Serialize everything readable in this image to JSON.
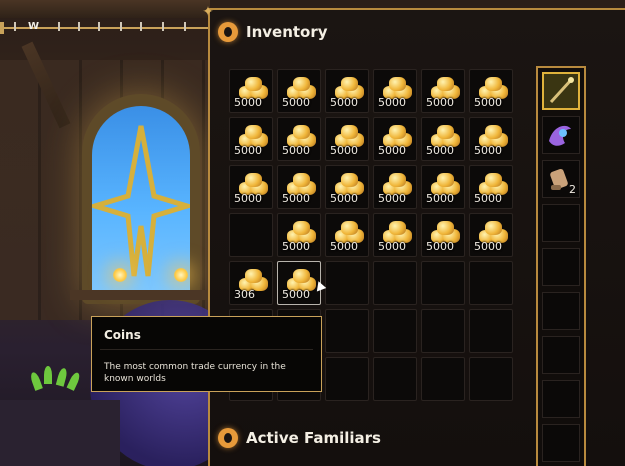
{
  "compass": {
    "heading_letter": "W"
  },
  "inventory": {
    "title": "Inventory",
    "slots": [
      {
        "item": "coins",
        "qty": "5000"
      },
      {
        "item": "coins",
        "qty": "5000"
      },
      {
        "item": "coins",
        "qty": "5000"
      },
      {
        "item": "coins",
        "qty": "5000"
      },
      {
        "item": "coins",
        "qty": "5000"
      },
      {
        "item": "coins",
        "qty": "5000"
      },
      {
        "item": "coins",
        "qty": "5000"
      },
      {
        "item": "coins",
        "qty": "5000"
      },
      {
        "item": "coins",
        "qty": "5000"
      },
      {
        "item": "coins",
        "qty": "5000"
      },
      {
        "item": "coins",
        "qty": "5000"
      },
      {
        "item": "coins",
        "qty": "5000"
      },
      {
        "item": "coins",
        "qty": "5000"
      },
      {
        "item": "coins",
        "qty": "5000"
      },
      {
        "item": "coins",
        "qty": "5000"
      },
      {
        "item": "coins",
        "qty": "5000"
      },
      {
        "item": "coins",
        "qty": "5000"
      },
      {
        "item": "coins",
        "qty": "5000"
      },
      {
        "item": "",
        "qty": ""
      },
      {
        "item": "coins",
        "qty": "5000"
      },
      {
        "item": "coins",
        "qty": "5000"
      },
      {
        "item": "coins",
        "qty": "5000"
      },
      {
        "item": "coins",
        "qty": "5000"
      },
      {
        "item": "coins",
        "qty": "5000"
      },
      {
        "item": "coins",
        "qty": "306"
      },
      {
        "item": "coins",
        "qty": "5000",
        "hovered": true
      },
      {
        "item": "",
        "qty": ""
      },
      {
        "item": "",
        "qty": ""
      },
      {
        "item": "",
        "qty": ""
      },
      {
        "item": "",
        "qty": ""
      },
      {
        "item": "",
        "qty": ""
      },
      {
        "item": "",
        "qty": ""
      },
      {
        "item": "",
        "qty": ""
      },
      {
        "item": "",
        "qty": ""
      },
      {
        "item": "",
        "qty": ""
      },
      {
        "item": "",
        "qty": ""
      },
      {
        "item": "",
        "qty": ""
      },
      {
        "item": "",
        "qty": ""
      },
      {
        "item": "",
        "qty": ""
      },
      {
        "item": "",
        "qty": ""
      },
      {
        "item": "",
        "qty": ""
      },
      {
        "item": "",
        "qty": ""
      }
    ]
  },
  "side_slots": [
    {
      "item": "wand",
      "qty": "",
      "selected": true
    },
    {
      "item": "purple-flower",
      "qty": ""
    },
    {
      "item": "scroll",
      "qty": "2"
    },
    {
      "item": "",
      "qty": ""
    },
    {
      "item": "",
      "qty": ""
    },
    {
      "item": "",
      "qty": ""
    },
    {
      "item": "",
      "qty": ""
    },
    {
      "item": "",
      "qty": ""
    },
    {
      "item": "",
      "qty": ""
    }
  ],
  "tooltip": {
    "title": "Coins",
    "description": "The most common trade currency in the known worlds"
  },
  "familiars": {
    "title": "Active Familiars"
  },
  "colors": {
    "accent_gold": "#b88a3e",
    "title_icon": "#e79a3a",
    "selected_slot": "#e0b33c"
  }
}
